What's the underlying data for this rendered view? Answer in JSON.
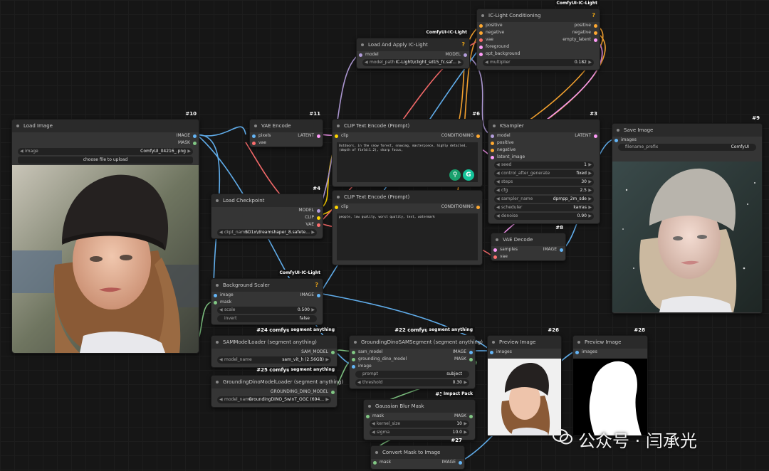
{
  "nodes": {
    "load_image": {
      "title": "Load Image",
      "id": "#10",
      "outputs": [
        "IMAGE",
        "MASK"
      ],
      "image_label": "image",
      "image_value": "ComfyUI_04216_.png",
      "upload_label": "choose file to upload"
    },
    "vae_encode": {
      "title": "VAE Encode",
      "id": "#11",
      "inputs": [
        "pixels",
        "vae"
      ],
      "outputs": [
        "LATENT"
      ]
    },
    "load_checkpoint": {
      "title": "Load Checkpoint",
      "id": "#4",
      "outputs": [
        "MODEL",
        "CLIP",
        "VAE"
      ],
      "ckpt_label": "ckpt_name",
      "ckpt_value": "SD1x\\dreamshaper_8.safete..."
    },
    "clip_pos": {
      "title": "CLIP Text Encode (Prompt)",
      "id": "#6",
      "inputs": [
        "clip"
      ],
      "outputs": [
        "CONDITIONING"
      ],
      "text": "Outdoors, in the snow forest, snowing, masterpiece, highly detailed,(depth of field:1.2), sharp focus,"
    },
    "clip_neg": {
      "title": "CLIP Text Encode (Prompt)",
      "inputs": [
        "clip"
      ],
      "outputs": [
        "CONDITIONING"
      ],
      "text": "people, low quality, worst quality, text, watermark"
    },
    "load_apply_ic": {
      "title": "Load And Apply IC-Light",
      "pack": "ComfyUI-IC-Light",
      "inputs": [
        "model"
      ],
      "outputs": [
        "MODEL"
      ],
      "model_path_label": "model_path",
      "model_path_value": "IC-Light\\iclight_sd15_fc.saf..."
    },
    "ic_conditioning": {
      "title": "IC-Light Conditioning",
      "pack": "ComfyUI-IC-Light",
      "inputs": [
        "positive",
        "negative",
        "vae",
        "foreground",
        "opt_background"
      ],
      "outputs": [
        "positive",
        "negative",
        "empty_latent"
      ],
      "multiplier_label": "multiplier",
      "multiplier_value": "0.182"
    },
    "ksampler": {
      "title": "KSampler",
      "id": "#3",
      "inputs": [
        "model",
        "positive",
        "negative",
        "latent_image"
      ],
      "outputs": [
        "LATENT"
      ],
      "widgets": [
        {
          "label": "seed",
          "value": "1"
        },
        {
          "label": "control_after_generate",
          "value": "fixed"
        },
        {
          "label": "steps",
          "value": "30"
        },
        {
          "label": "cfg",
          "value": "2.5"
        },
        {
          "label": "sampler_name",
          "value": "dpmpp_2m_sde"
        },
        {
          "label": "scheduler",
          "value": "karras"
        },
        {
          "label": "denoise",
          "value": "0.90"
        }
      ]
    },
    "save_image": {
      "title": "Save Image",
      "id": "#9",
      "inputs": [
        "images"
      ],
      "prefix_label": "filename_prefix",
      "prefix_value": "ComfyUI"
    },
    "vae_decode": {
      "title": "VAE Decode",
      "id": "#8",
      "inputs": [
        "samples",
        "vae"
      ],
      "outputs": [
        "IMAGE"
      ]
    },
    "bg_scaler": {
      "title": "Background Scaler",
      "pack": "ComfyUI-IC-Light",
      "inputs": [
        "image",
        "mask"
      ],
      "outputs": [
        "IMAGE"
      ],
      "scale_label": "scale",
      "scale_value": "0.500",
      "invert_label": "invert",
      "invert_value": "false"
    },
    "sam_loader": {
      "title": "SAMModelLoader (segment anything)",
      "id": "#24 comfyui_",
      "pack": "segment anything",
      "outputs": [
        "SAM_MODEL"
      ],
      "model_label": "model_name",
      "model_value": "sam_vit_h (2.56GB)"
    },
    "gdino_loader": {
      "title": "GroundingDinoModelLoader (segment anything)",
      "id": "#25 comfyui_",
      "pack": "segment anything",
      "outputs": [
        "GROUNDING_DINO_MODEL"
      ],
      "model_label": "model_name",
      "model_value": "GroundingDINO_SwinT_OGC (694..."
    },
    "gdino_sam": {
      "title": "GroundingDinoSAMSegment (segment anything)",
      "id": "#22 comfyui_",
      "pack": "segment anything",
      "inputs": [
        "sam_model",
        "grounding_dino_model",
        "image"
      ],
      "outputs": [
        "IMAGE",
        "MASK"
      ],
      "prompt_label": "prompt",
      "prompt_value": "subject",
      "threshold_label": "threshold",
      "threshold_value": "0.30"
    },
    "preview1": {
      "title": "Preview Image",
      "id": "#26",
      "inputs": [
        "images"
      ]
    },
    "preview2": {
      "title": "Preview Image",
      "id": "#28",
      "inputs": [
        "images"
      ]
    },
    "gauss_blur": {
      "title": "Gaussian Blur Mask",
      "id": "#32",
      "pack": "Impact Pack",
      "inputs": [
        "mask"
      ],
      "outputs": [
        "MASK"
      ],
      "kernel_label": "kernel_size",
      "kernel_value": "10",
      "sigma_label": "sigma",
      "sigma_value": "10.0"
    },
    "mask_to_image": {
      "title": "Convert Mask to Image",
      "id": "#27",
      "inputs": [
        "mask"
      ],
      "outputs": [
        "IMAGE"
      ]
    }
  },
  "watermark": "公众号 · 闫承光",
  "colors": {
    "image": "#64b5f6",
    "mask": "#81c784",
    "latent": "#ff9cf9",
    "model": "#b39ddb",
    "clip": "#ffd500",
    "vae": "#ff6e6e",
    "conditioning": "#ffa931"
  }
}
